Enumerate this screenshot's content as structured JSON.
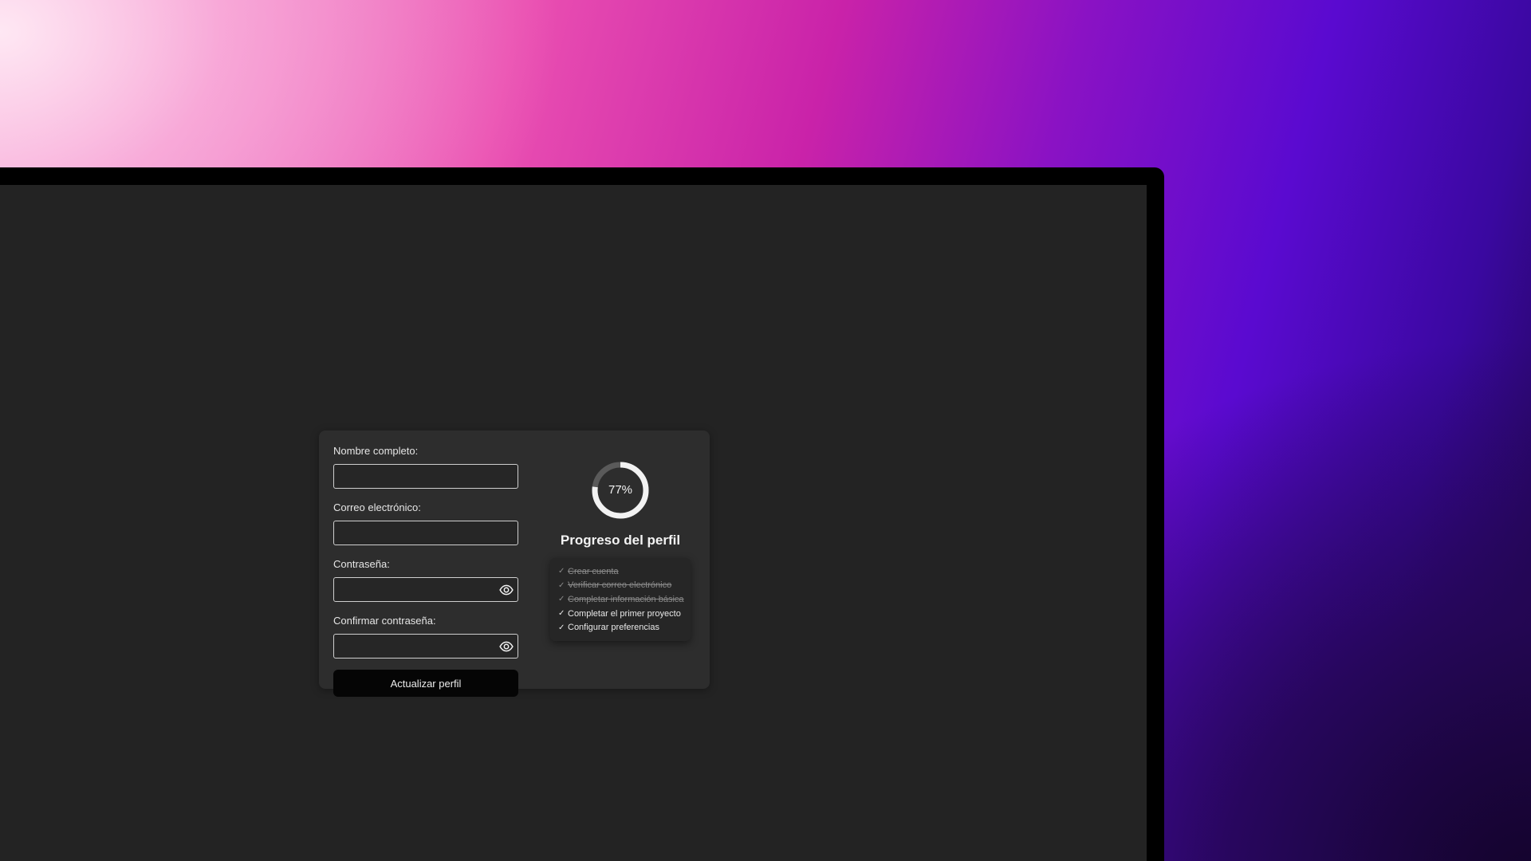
{
  "form": {
    "fields": [
      {
        "label": "Nombre completo:",
        "value": "",
        "type": "text"
      },
      {
        "label": "Correo electrónico:",
        "value": "",
        "type": "email"
      },
      {
        "label": "Contraseña:",
        "value": "",
        "type": "password"
      },
      {
        "label": "Confirmar contraseña:",
        "value": "",
        "type": "password"
      }
    ],
    "submit_label": "Actualizar perfil"
  },
  "progress": {
    "percent": 77,
    "percent_label": "77%",
    "title": "Progreso del perfil",
    "checklist": [
      {
        "mark": "✓",
        "label": "Crear cuenta",
        "done": true
      },
      {
        "mark": "✓",
        "label": "Verificar correo electrónico",
        "done": true
      },
      {
        "mark": "✓",
        "label": "Completar información básica",
        "done": true
      },
      {
        "mark": "✓",
        "label": "Completar el primer proyecto",
        "done": false
      },
      {
        "mark": "✓",
        "label": "Configurar preferencias",
        "done": false
      }
    ]
  },
  "icons": {
    "password_toggle": "eye-icon"
  },
  "colors": {
    "ring_track": "#5a5a5a",
    "ring_fill": "#f2f2f2",
    "card_bg": "#2d2d2d",
    "window_bg": "#232323"
  }
}
